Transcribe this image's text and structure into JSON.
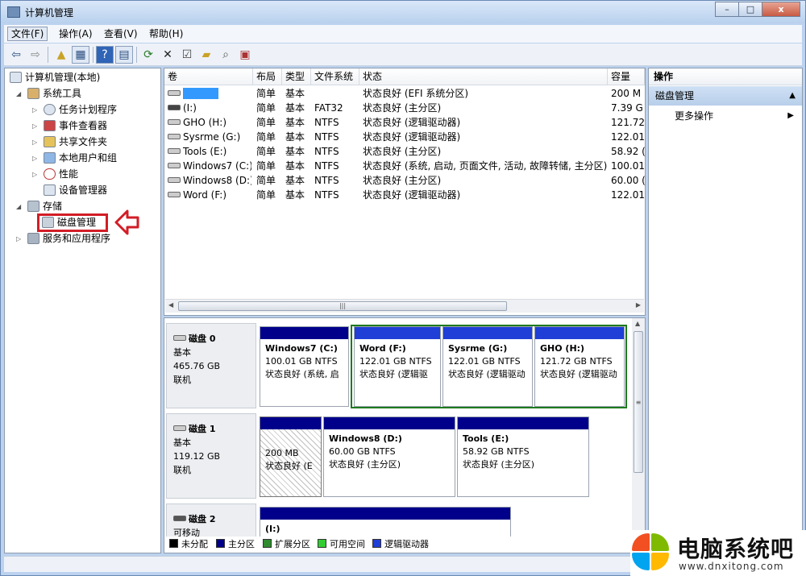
{
  "window": {
    "title": "计算机管理",
    "controls": {
      "minimize": "–",
      "maximize": "□",
      "close": "x"
    }
  },
  "menubar": [
    "文件(F)",
    "操作(A)",
    "查看(V)",
    "帮助(H)"
  ],
  "toolbar_icons": [
    "back-icon",
    "forward-icon",
    "up-folder-icon",
    "show-tree-icon",
    "help-icon",
    "console-icon",
    "refresh-icon",
    "delete-icon",
    "properties-icon",
    "open-icon",
    "search-icon",
    "export-icon"
  ],
  "tree": {
    "root": "计算机管理(本地)",
    "system_tools": "系统工具",
    "task_scheduler": "任务计划程序",
    "event_viewer": "事件查看器",
    "shared_folders": "共享文件夹",
    "local_users": "本地用户和组",
    "performance": "性能",
    "device_manager": "设备管理器",
    "storage": "存储",
    "disk_management": "磁盘管理",
    "services": "服务和应用程序"
  },
  "volume_list": {
    "columns": [
      "卷",
      "布局",
      "类型",
      "文件系统",
      "状态",
      "容量"
    ],
    "rows": [
      {
        "volume": "",
        "layout": "简单",
        "type": "基本",
        "fs": "",
        "status": "状态良好 (EFI 系统分区)",
        "capacity": "200 M"
      },
      {
        "volume": "(I:)",
        "layout": "简单",
        "type": "基本",
        "fs": "FAT32",
        "status": "状态良好 (主分区)",
        "capacity": "7.39 G"
      },
      {
        "volume": "GHO (H:)",
        "layout": "简单",
        "type": "基本",
        "fs": "NTFS",
        "status": "状态良好 (逻辑驱动器)",
        "capacity": "121.72"
      },
      {
        "volume": "Sysrme (G:)",
        "layout": "简单",
        "type": "基本",
        "fs": "NTFS",
        "status": "状态良好 (逻辑驱动器)",
        "capacity": "122.01"
      },
      {
        "volume": "Tools (E:)",
        "layout": "简单",
        "type": "基本",
        "fs": "NTFS",
        "status": "状态良好 (主分区)",
        "capacity": "58.92 ("
      },
      {
        "volume": "Windows7 (C:)",
        "layout": "简单",
        "type": "基本",
        "fs": "NTFS",
        "status": "状态良好 (系统, 启动, 页面文件, 活动, 故障转储, 主分区)",
        "capacity": "100.01"
      },
      {
        "volume": "Windows8 (D:)",
        "layout": "简单",
        "type": "基本",
        "fs": "NTFS",
        "status": "状态良好 (主分区)",
        "capacity": "60.00 ("
      },
      {
        "volume": "Word (F:)",
        "layout": "简单",
        "type": "基本",
        "fs": "NTFS",
        "status": "状态良好 (逻辑驱动器)",
        "capacity": "122.01"
      }
    ]
  },
  "disks": [
    {
      "name": "磁盘 0",
      "kind": "基本",
      "size": "465.76 GB",
      "state": "联机",
      "parts": [
        {
          "title": "Windows7  (C:)",
          "size": "100.01 GB NTFS",
          "status": "状态良好 (系统, 启"
        },
        {
          "title": "Word  (F:)",
          "size": "122.01 GB NTFS",
          "status": "状态良好 (逻辑驱"
        },
        {
          "title": "Sysrme  (G:)",
          "size": "122.01 GB NTFS",
          "status": "状态良好 (逻辑驱动"
        },
        {
          "title": "GHO  (H:)",
          "size": "121.72 GB NTFS",
          "status": "状态良好 (逻辑驱动"
        }
      ]
    },
    {
      "name": "磁盘 1",
      "kind": "基本",
      "size": "119.12 GB",
      "state": "联机",
      "parts": [
        {
          "title": "",
          "size": "200 MB",
          "status": "状态良好 (E"
        },
        {
          "title": "Windows8  (D:)",
          "size": "60.00 GB NTFS",
          "status": "状态良好 (主分区)"
        },
        {
          "title": "Tools  (E:)",
          "size": "58.92 GB NTFS",
          "status": "状态良好 (主分区)"
        }
      ]
    },
    {
      "name": "磁盘 2",
      "kind": "可移动",
      "size": "",
      "state": "",
      "parts": [
        {
          "title": "(I:)",
          "size": "",
          "status": ""
        }
      ]
    }
  ],
  "legend": [
    {
      "label": "未分配",
      "color": "#000000"
    },
    {
      "label": "主分区",
      "color": "#00008b"
    },
    {
      "label": "扩展分区",
      "color": "#2e8b2e"
    },
    {
      "label": "可用空间",
      "color": "#32cd32"
    },
    {
      "label": "逻辑驱动器",
      "color": "#1f3fd6"
    }
  ],
  "actions": {
    "header": "操作",
    "section": "磁盘管理",
    "more": "更多操作"
  },
  "watermark": {
    "brand": "电脑系统吧",
    "url": "www.dnxitong.com"
  },
  "colors": {
    "primary": "#00008b",
    "logical": "#1f3fd6",
    "extended_border": "#1e7a1e",
    "highlight": "#d21d26",
    "selection": "#3399ff"
  }
}
